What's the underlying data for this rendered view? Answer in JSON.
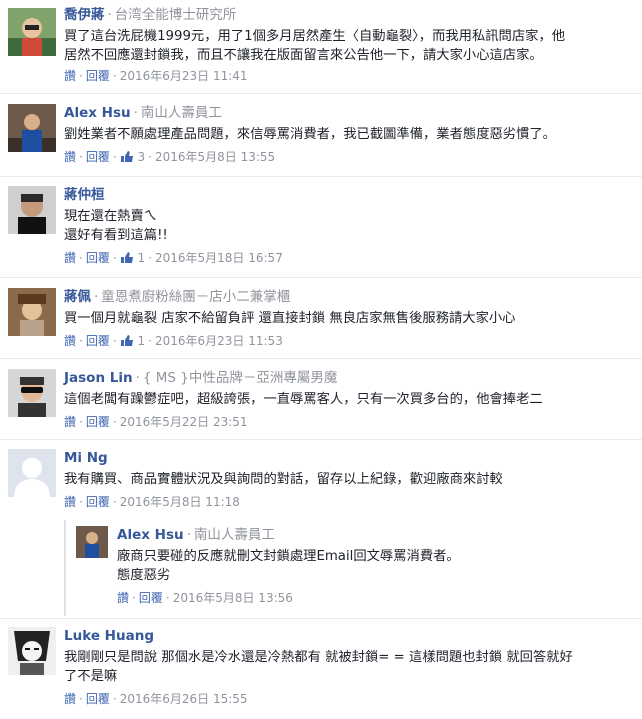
{
  "comments": [
    {
      "name": "喬伊蔣",
      "affiliation": "台湾全能博士研究所",
      "lines": [
        "買了這台洗屁機1999元，用了1個多月居然產生〈自動龜裂〉，而我用私訊問店家，他",
        "居然不回應還封鎖我，而且不讓我在版面留言來公告他一下，請大家小心這店家。"
      ],
      "reply": "讚",
      "respond": "回覆",
      "likes": "",
      "date": "2016年6月23日 11:41"
    },
    {
      "name": "Alex Hsu",
      "affiliation": "南山人壽員工",
      "lines": [
        "劉姓業者不願處理產品問題，來信辱罵消費者，我已截圖準備，業者態度惡劣慣了。"
      ],
      "reply": "讚",
      "respond": "回覆",
      "likes": "3",
      "date": "2016年5月8日 13:55"
    },
    {
      "name": "蔣仲桓",
      "affiliation": "",
      "lines": [
        "現在還在熱賣ㄟ",
        "還好有看到這篇!!"
      ],
      "reply": "讚",
      "respond": "回覆",
      "likes": "1",
      "date": "2016年5月18日 16:57"
    },
    {
      "name": "蔣佩",
      "affiliation": "童恩煮廚粉絲團－店小二兼掌櫃",
      "lines": [
        "買一個月就龜裂 店家不給留負評 還直接封鎖 無良店家無售後服務請大家小心"
      ],
      "reply": "讚",
      "respond": "回覆",
      "likes": "1",
      "date": "2016年6月23日 11:53"
    },
    {
      "name": "Jason Lin",
      "affiliation": "{ MS }中性品牌－亞洲專屬男魔",
      "lines": [
        "這個老闆有躁鬱症吧，超級誇張，一直辱罵客人，只有一次買多台的，他會捧老二"
      ],
      "reply": "讚",
      "respond": "回覆",
      "likes": "",
      "date": "2016年5月22日 23:51"
    },
    {
      "name": "Mi Ng",
      "affiliation": "",
      "lines": [
        "我有購買、商品實體狀況及與詢問的對話，留存以上紀錄，歡迎廠商來討較"
      ],
      "reply": "讚",
      "respond": "回覆",
      "likes": "",
      "date": "2016年5月8日 11:18"
    },
    {
      "name": "Alex Hsu",
      "affiliation": "南山人壽員工",
      "lines": [
        "廠商只要碰的反應就刪文封鎖處理Email回文辱罵消費者。",
        "態度惡劣"
      ],
      "reply": "讚",
      "respond": "回覆",
      "likes": "",
      "date": "2016年5月8日 13:56"
    },
    {
      "name": "Luke Huang",
      "affiliation": "",
      "lines": [
        "我剛剛只是問說 那個水是冷水還是冷熱都有 就被封鎖= = 這樣問題也封鎖 就回答就好",
        "了不是嘛"
      ],
      "reply": "讚",
      "respond": "回覆",
      "likes": "",
      "date": "2016年6月26日 15:55"
    }
  ],
  "colors": {
    "name": "#365899",
    "link": "#4267b2",
    "meta": "#90949c",
    "text": "#1d2129"
  }
}
